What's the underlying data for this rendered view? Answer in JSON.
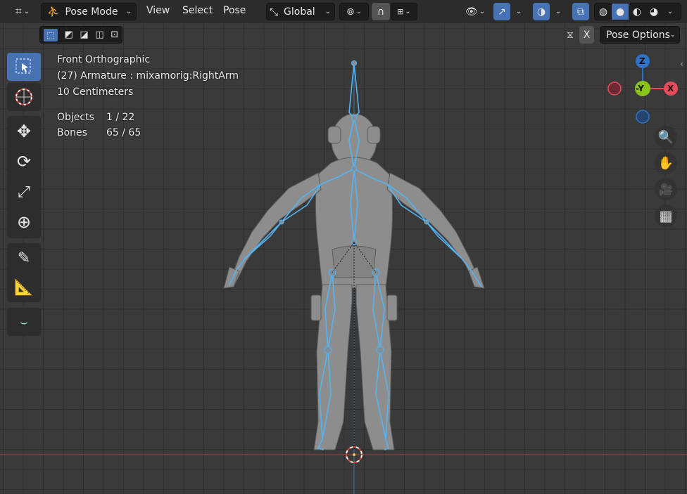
{
  "header": {
    "mode": "Pose Mode",
    "menus": [
      "View",
      "Select",
      "Pose"
    ],
    "orientation": "Global",
    "pose_options": "Pose Options",
    "x_mirror": "X"
  },
  "overlay": {
    "view_name": "Front Orthographic",
    "active": "(27) Armature : mixamorig:RightArm",
    "scale": "10 Centimeters",
    "objects_label": "Objects",
    "objects_value": "1 / 22",
    "bones_label": "Bones",
    "bones_value": "65 / 65"
  },
  "gizmo": {
    "z": "Z",
    "y": "-Y",
    "x": "X",
    "colors": {
      "x": "#e74b5a",
      "y": "#8bc31d",
      "z": "#2e73c5"
    }
  },
  "toolbar": {
    "tools": [
      "select-box",
      "cursor",
      "move",
      "rotate",
      "scale",
      "transform",
      "annotate",
      "measure",
      "breakdowner"
    ]
  },
  "colors": {
    "accent": "#4772b3",
    "bone": "#55b4f0",
    "mesh": "#8e8e8e",
    "grid": "#3a3a3a"
  }
}
